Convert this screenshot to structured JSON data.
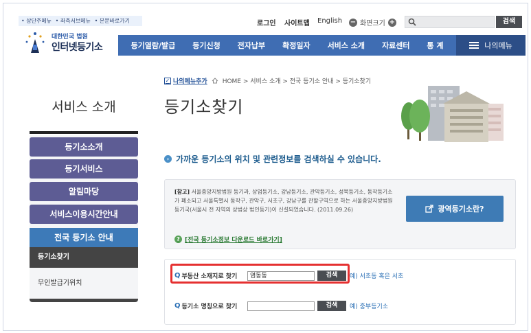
{
  "skip_links": [
    "• 상단주메뉴",
    "• 좌측서브메뉴",
    "• 본문바로가기"
  ],
  "logo": {
    "sub": "대한민국 법원",
    "main": "인터넷등기소"
  },
  "util": {
    "login": "로그인",
    "sitemap": "사이트맵",
    "english": "English",
    "zoom_label": "화면크기",
    "zoom_minus": "−",
    "zoom_plus": "+"
  },
  "search": {
    "placeholder": "",
    "button": "검색"
  },
  "nav": [
    "등기열람/발급",
    "등기신청",
    "전자납부",
    "확정일자",
    "서비스 소개",
    "자료센터",
    "통 계"
  ],
  "my_menu": "나의메뉴",
  "breadcrumb": {
    "add": "나의메뉴추가",
    "path": "HOME > 서비스 소개 > 전국 등기소 안내 > 등기소찾기"
  },
  "sidebar": {
    "title": "서비스 소개",
    "items": [
      "등기소소개",
      "등기서비스",
      "알림마당",
      "서비스이용시간안내"
    ],
    "active": "전국 등기소 안내",
    "subs": [
      "등기소찾기",
      "무인발급기위치"
    ]
  },
  "page": {
    "title": "등기소찾기",
    "intro": "가까운 등기소의 위치 및 관련정보를 검색하실 수 있습니다.",
    "note_label": "[참고]",
    "note_body": "서울중앙지방법원 등기과, 상업등기소, 강남등기소, 관악등기소, 성북등기소, 동작등기소가 폐소되고 서울특별시 동작구, 관악구, 서초구, 강남구를 관할구역으로 하는 서울중앙지방법원 등기국(서울시 전 지역의 상법상 법인등기)이 신설되었습니다. (2011.09.26)",
    "note_link": "[전국 등기소정보 다운로드 바로가기]",
    "wide_btn": "광역등기소란?"
  },
  "search_rows": [
    {
      "label": "부동산 소재지로 찾기",
      "value": "염동동",
      "button": "검색",
      "example": "예) 서초동 혹은 서초"
    },
    {
      "label": "등기소 명칭으로 찾기",
      "value": "",
      "button": "검색",
      "example": "예) 중부등기소"
    }
  ],
  "colors": {
    "nav": "#3f6db3",
    "sidebar_btn": "#5d5c94",
    "active": "#3d7ab8",
    "highlight": "#e53030"
  }
}
